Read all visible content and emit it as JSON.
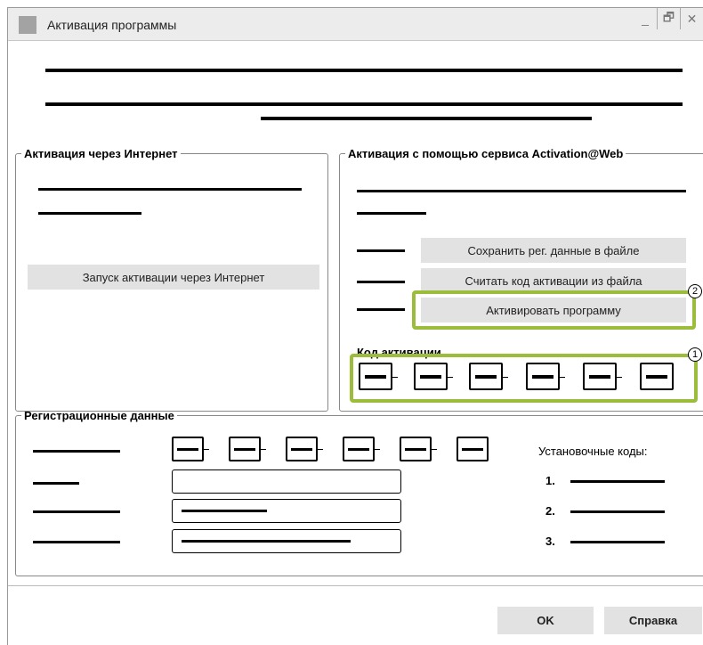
{
  "window": {
    "title": "Активация программы"
  },
  "controls": {
    "minimize": "_",
    "restore": "🗗",
    "close": "✕"
  },
  "internet_group": {
    "legend": "Активация через Интернет",
    "start_button": "Запуск активации через Интернет"
  },
  "web_group": {
    "legend": "Активация с помощью сервиса Activation@Web",
    "save_button": "Сохранить рег. данные в файле",
    "read_button": "Считать код активации из файла",
    "activate_button": "Активировать программу",
    "code_label": "Код активации",
    "callout_code": "1",
    "callout_activate": "2"
  },
  "registration_group": {
    "legend": "Регистрационные данные",
    "install_codes_label": "Установочные коды:",
    "install_codes": [
      "1.",
      "2.",
      "3."
    ]
  },
  "footer": {
    "ok_button": "OK",
    "help_button": "Справка"
  },
  "colors": {
    "highlight": "#9cbd3c",
    "button": "#e2e2e2"
  }
}
